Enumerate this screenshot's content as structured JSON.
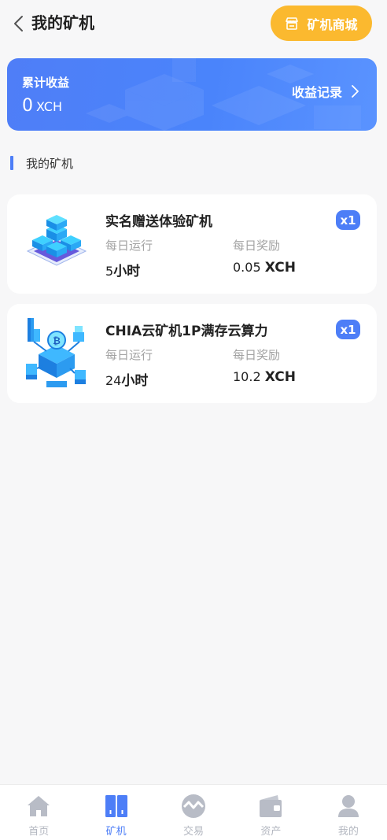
{
  "header": {
    "title": "我的矿机",
    "shop_button_label": "矿机商城"
  },
  "earnings": {
    "label": "累计收益",
    "value": "0",
    "unit": "XCH",
    "record_label": "收益记录"
  },
  "section": {
    "title": "我的矿机"
  },
  "miners": [
    {
      "name": "实名赠送体验矿机",
      "badge": "x1",
      "run_label": "每日运行",
      "reward_label": "每日奖励",
      "run_value": "5",
      "run_unit": "小时",
      "reward_value": "0.05",
      "reward_unit": "XCH"
    },
    {
      "name": "CHIA云矿机1P满存云算力",
      "badge": "x1",
      "run_label": "每日运行",
      "reward_label": "每日奖励",
      "run_value": "24",
      "run_unit": "小时",
      "reward_value": "10.2",
      "reward_unit": "XCH"
    }
  ],
  "tabs": [
    {
      "label": "首页",
      "icon": "home-icon",
      "active": false
    },
    {
      "label": "矿机",
      "icon": "miner-icon",
      "active": true
    },
    {
      "label": "交易",
      "icon": "trade-icon",
      "active": false
    },
    {
      "label": "资产",
      "icon": "wallet-icon",
      "active": false
    },
    {
      "label": "我的",
      "icon": "user-icon",
      "active": false
    }
  ],
  "colors": {
    "accent": "#4d7ef7",
    "shop_button": "#fbb92f",
    "tab_inactive": "#b3b7c0"
  }
}
